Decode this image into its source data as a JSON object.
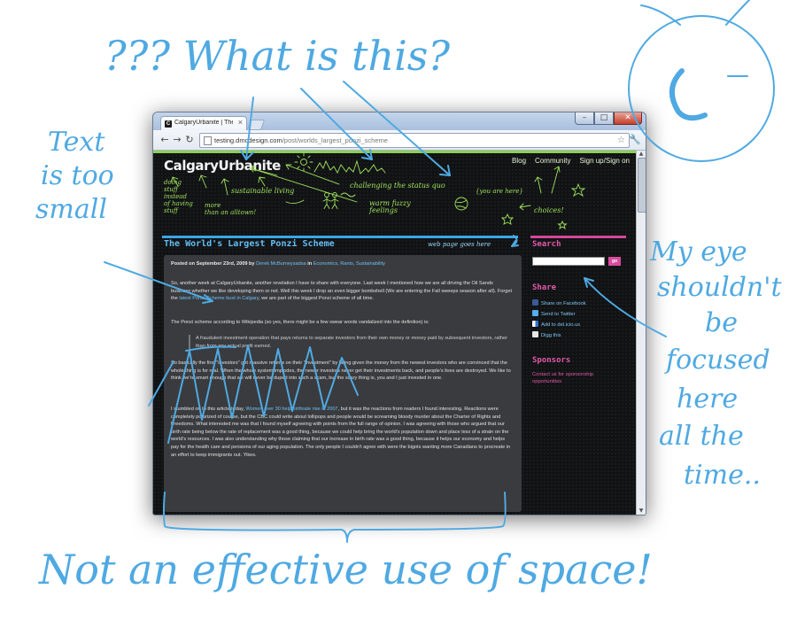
{
  "browser": {
    "tab_title": "CalgaryUrbanite | The W...",
    "tab_favicon": "C",
    "url_host": "testing.dmcdesign.com",
    "url_path": "/post/worlds_largest_ponzi_scheme"
  },
  "site": {
    "logo": "CalgaryUrbanite",
    "nav": [
      "Blog",
      "Community",
      "Sign up/Sign on"
    ],
    "chalk_notes": {
      "doing_stuff": "doing\nstuff\ninstead\nof having\nstuff",
      "sustainable": "sustainable living",
      "alltown": "more\nthan an alltown!",
      "status_quo": "challenging the status quo",
      "warm_fuzzy": "warm fuzzy\nfeelings",
      "you_are_here": "{you are here}",
      "choices": "choices!"
    }
  },
  "post": {
    "title": "The World's Largest Ponzi Scheme",
    "note": "web page goes here",
    "meta_prefix": "Posted on September 23rd, 2009 by",
    "author": "Derek McBurneysadsa",
    "meta_in": "in",
    "categories": "Economics, Rants, Sustainability",
    "p1_a": "So, another week at CalgaryUrbanite, another revelation I have to share with everyone. Last week I mentioned how we are all driving the Oil Sands business whether we like developing them or not.  Well this week I drop an even bigger bombshell (We are entering the Fall sweeps season after all).  Forget the",
    "p1_link": "latest Ponzi-Scheme bust in Calgary",
    "p1_b": ", we are part of the biggest Ponzi scheme of all time.",
    "p2": "The Ponzi scheme according to Wikipedia (so yes, there might be a few swear words vandalized into the definition) is:",
    "quote": "A fraudulent investment operation that pays returns to separate investors from their own money or money paid by subsequent investors, rather than from any actual profit earned.",
    "p3": "So basically the first \"investors\" get massive returns on their \"investment\" by being given the money from the newest investors who are convinced that the whole thing is for real.  When the whole system implodes, the newer investors never get their investments back, and people's lives are destroyed.  We like to think we're smart enough that we will never be duped into such a scam, but the scary thing is, you and I just invested in one.",
    "p4_a": "I stumbled on to this article today,",
    "p4_link": "Women over 30 help birthrate rise in 2007",
    "p4_b": ", but it was the reactions from readers I found interesting.  Reactions were completely polarized of course, but the CBC could write about lollipops and people would be screaming bloody murder about the Charter of Rights and Freedoms.  What interested me was that I found myself agreeing with points from the full range of opinion.  I was agreeing with those who argued that our birth rate being below the rate of replacement was a good thing, because we could help bring the world's population down and place less of a strain on the world's resources.  I was also understanding why those claiming that our increase in birth rate was a good thing, because it helps our economy and helps pay for the health care and pensions of our aging population.  The only people I couldn't agree with were the bigots wanting more Canadians to procreate in an effort to keep immigrants out.  Yikes."
  },
  "sidebar": {
    "search_heading": "Search",
    "search_button": "go",
    "share_heading": "Share",
    "share_items": [
      "Share on Facebook",
      "Send to Twitter",
      "Add to del.icio.us",
      "Digg this"
    ],
    "sponsors_heading": "Sponsors",
    "sponsors_link": "Contact us for sponsorship opportunities"
  },
  "annotations": {
    "what": "??? What is this?",
    "text_small_1": "Text",
    "text_small_2": "is too",
    "text_small_3": "small",
    "eye_1": "My eye",
    "eye_2": "shouldn't",
    "eye_3": "be",
    "eye_4": "focused",
    "eye_5": "here",
    "eye_6": "all the",
    "eye_7": "time..",
    "space": "Not an effective use of space!",
    "face_letter": "C"
  },
  "colors": {
    "annotation": "#4fa9e2",
    "accent_blue": "#3aa7e8",
    "accent_pink": "#d6479a",
    "chalk_green": "#9fe35d"
  }
}
